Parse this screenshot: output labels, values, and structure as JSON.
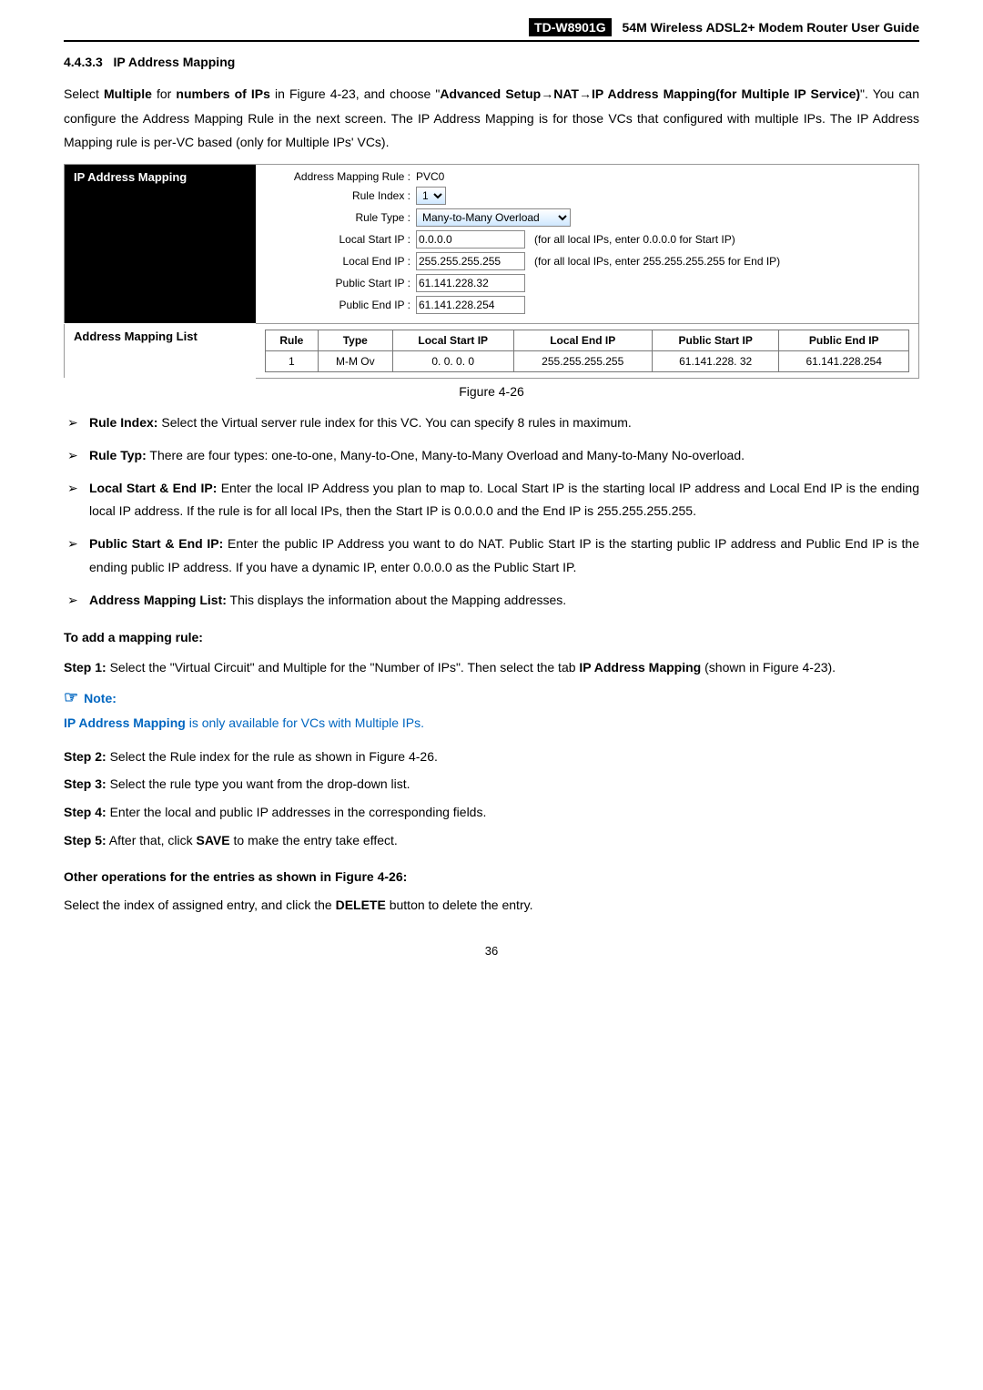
{
  "header": {
    "model": "TD-W8901G",
    "title": "54M Wireless ADSL2+ Modem Router User Guide"
  },
  "section": {
    "number": "4.4.3.3",
    "title": "IP Address Mapping"
  },
  "intro": {
    "p1_a": "Select ",
    "p1_b": "Multiple",
    "p1_c": " for ",
    "p1_d": "numbers of IPs",
    "p1_e": " in Figure 4-23, and choose \"",
    "p1_f": "Advanced Setup",
    "p1_g": "NAT",
    "p1_h": "IP Address Mapping(for Multiple IP Service)",
    "p1_i": "\". You can configure the Address Mapping Rule in the next screen. The IP Address Mapping is for those VCs that configured with multiple IPs. The IP Address Mapping rule is per-VC based (only for Multiple IPs' VCs)."
  },
  "panel": {
    "bar1": "IP Address Mapping",
    "bar2": "Address Mapping List",
    "addr_rule_lbl": "Address Mapping Rule :",
    "addr_rule_val": "PVC0",
    "rule_index_lbl": "Rule Index :",
    "rule_index_val": "1",
    "rule_type_lbl": "Rule Type :",
    "rule_type_val": "Many-to-Many Overload",
    "lstart_lbl": "Local Start IP :",
    "lstart_val": "0.0.0.0",
    "lstart_hint": "(for all local IPs, enter 0.0.0.0 for Start IP)",
    "lend_lbl": "Local End IP :",
    "lend_val": "255.255.255.255",
    "lend_hint": "(for all local IPs, enter 255.255.255.255 for End IP)",
    "pstart_lbl": "Public Start IP :",
    "pstart_val": "61.141.228.32",
    "pend_lbl": "Public End IP :",
    "pend_val": "61.141.228.254",
    "table": {
      "headers": [
        "Rule",
        "Type",
        "Local Start IP",
        "Local End IP",
        "Public Start IP",
        "Public End IP"
      ],
      "row": [
        "1",
        "M-M Ov",
        "0. 0. 0. 0",
        "255.255.255.255",
        "61.141.228. 32",
        "61.141.228.254"
      ]
    }
  },
  "fig_caption": "Figure 4-26",
  "bullets": [
    {
      "b": "Rule Index:",
      "t": " Select the Virtual server rule index for this VC. You can specify 8 rules in maximum."
    },
    {
      "b": "Rule Typ:",
      "t": " There are four types: one-to-one, Many-to-One, Many-to-Many Overload and Many-to-Many No-overload."
    },
    {
      "b": "Local Start & End IP:",
      "t": " Enter the local IP Address you plan to map to. Local Start IP is the starting local IP address and Local End IP is the ending local IP address. If the rule is for all local IPs, then the Start IP is 0.0.0.0 and the End IP is 255.255.255.255."
    },
    {
      "b": "Public Start & End IP:",
      "t": " Enter the public IP Address you want to do NAT. Public Start IP is the starting public IP address and Public End IP is the ending public IP address. If you have a dynamic IP, enter 0.0.0.0 as the Public Start IP."
    },
    {
      "b": "Address Mapping List:",
      "t": " This displays the information about the Mapping addresses."
    }
  ],
  "add_rule_heading": "To add a mapping rule:",
  "step1_a": "Step 1:",
  "step1_b": "  Select the \"Virtual Circuit\" and Multiple for the \"Number of IPs\". Then select the tab ",
  "step1_c": "IP Address Mapping",
  "step1_d": " (shown in Figure 4-23).",
  "note_label": "Note:",
  "note_text_a": "IP Address Mapping",
  "note_text_b": " is only available for VCs with Multiple IPs.",
  "steps": [
    {
      "n": "Step 2:",
      "t": "  Select the Rule index for the rule as shown in Figure 4-26."
    },
    {
      "n": "Step 3:",
      "t": "  Select the rule type you want from the drop-down list."
    },
    {
      "n": "Step 4:",
      "t": "  Enter the local and public IP addresses in the corresponding fields."
    }
  ],
  "step5_a": "Step 5:",
  "step5_b": "  After that, click ",
  "step5_c": "SAVE",
  "step5_d": " to make the entry take effect.",
  "other_heading": "Other operations for the entries as shown in Figure 4-26:",
  "other_text_a": "Select the index of assigned entry, and click the ",
  "other_text_b": "DELETE",
  "other_text_c": " button to delete the entry.",
  "page_number": "36"
}
